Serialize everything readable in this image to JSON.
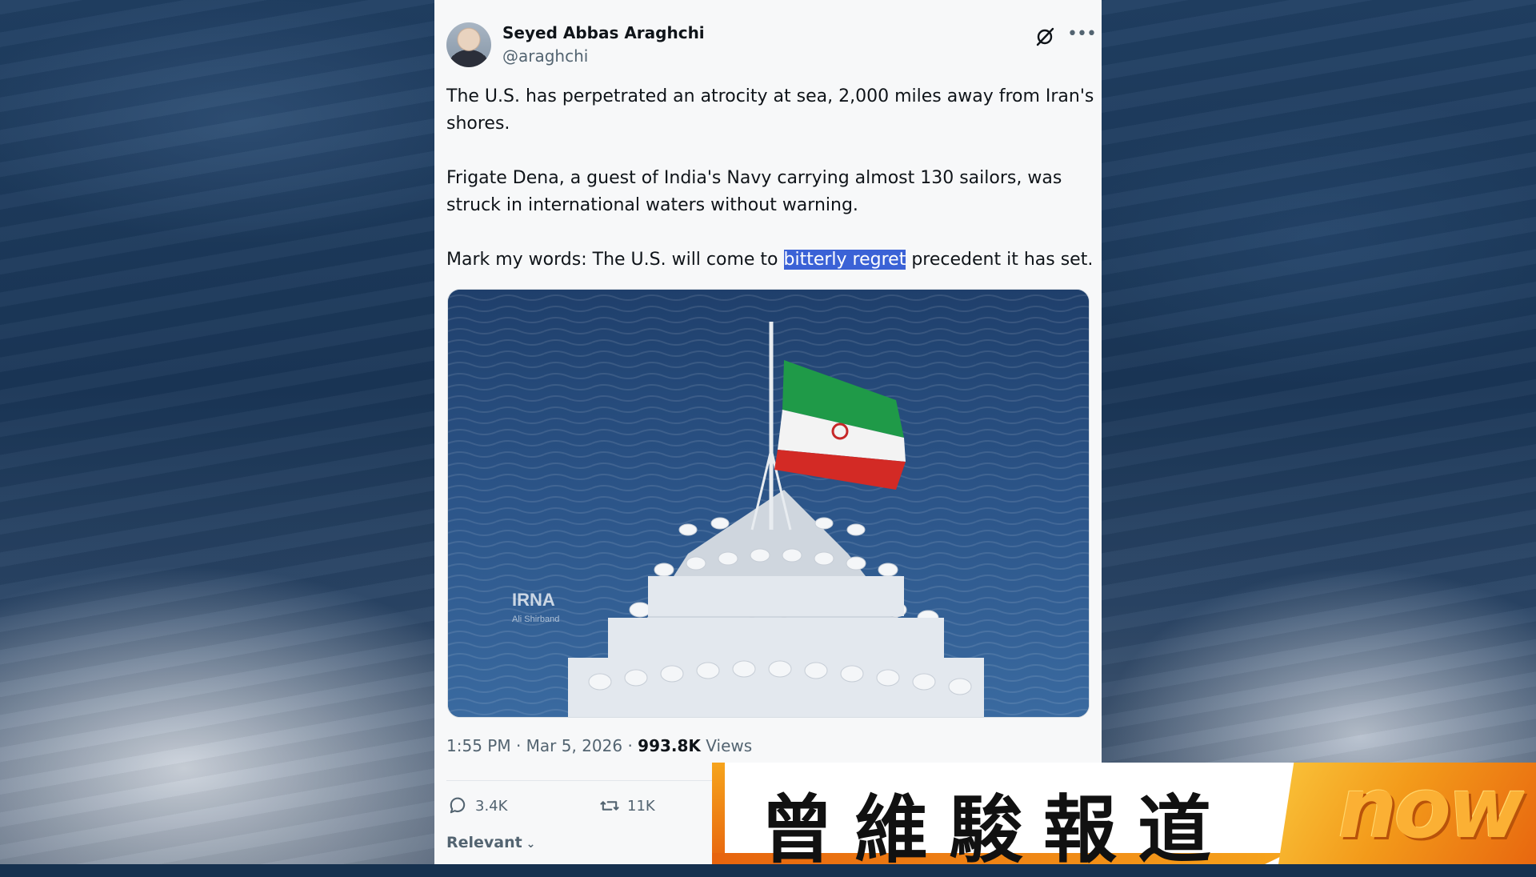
{
  "post": {
    "author_name": "Seyed Abbas Araghchi",
    "author_handle": "@araghchi",
    "paragraph_1": "The U.S. has perpetrated an atrocity at sea, 2,000 miles away from Iran's shores.",
    "paragraph_2": "Frigate Dena, a guest of India's Navy carrying almost 130 sailors, was struck in international waters without warning.",
    "paragraph_3_before": "Mark my words: The U.S. will come to ",
    "paragraph_3_highlight": "bitterly regret",
    "paragraph_3_after": " precedent it has set.",
    "image_watermark": "IRNA",
    "image_credit": "Ali Shirband",
    "timestamp": "1:55 PM · Mar 5, 2026 · ",
    "views_count": "993.8K",
    "views_label": " Views",
    "replies": "3.4K",
    "reposts": "11K",
    "sort_label": "Relevant"
  },
  "broadcast": {
    "caption": "曾維駿報道",
    "logo": "now"
  },
  "colors": {
    "highlight": "#3b62d6",
    "flag_green": "#1f9a48",
    "flag_red": "#d32a25",
    "logo_orange": "#f39a1a"
  }
}
